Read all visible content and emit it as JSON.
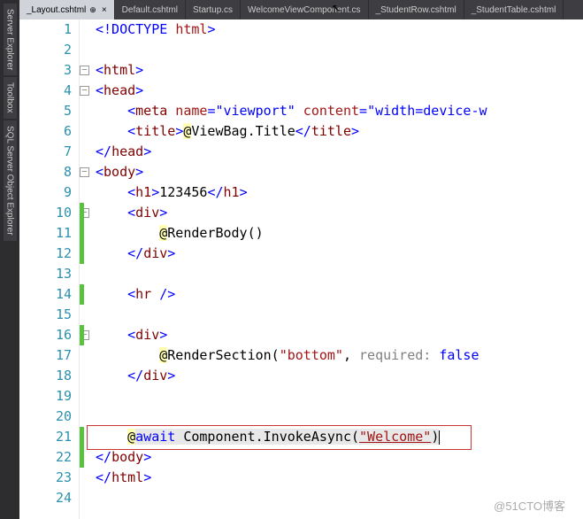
{
  "sidebar": {
    "tabs": [
      "Server Explorer",
      "Toolbox",
      "SQL Server Object Explorer"
    ]
  },
  "tabs": [
    {
      "label": "_Layout.cshtml",
      "active": true,
      "pinned": true
    },
    {
      "label": "Default.cshtml"
    },
    {
      "label": "Startup.cs"
    },
    {
      "label": "WelcomeViewComponent.cs"
    },
    {
      "label": "_StudentRow.cshtml"
    },
    {
      "label": "_StudentTable.cshtml"
    }
  ],
  "code": {
    "l1": {
      "doctype": "<!DOCTYPE ",
      "html": "html",
      "close": ">"
    },
    "l3": {
      "open": "<",
      "tag": "html",
      "close": ">"
    },
    "l4": {
      "open": "<",
      "tag": "head",
      "close": ">"
    },
    "l5": {
      "open": "<",
      "tag": "meta",
      "name_attr": " name",
      "eq": "=",
      "name_val": "\"viewport\"",
      "content_attr": " content",
      "content_val": "\"width=device-w"
    },
    "l6": {
      "open": "<",
      "tag": "title",
      "close": ">",
      "at": "@",
      "razor": "ViewBag.Title",
      "copen": "</",
      "cclose": ">"
    },
    "l7": {
      "open": "</",
      "tag": "head",
      "close": ">"
    },
    "l8": {
      "open": "<",
      "tag": "body",
      "close": ">"
    },
    "l9": {
      "open": "<",
      "tag": "h1",
      "close": ">",
      "text": "123456",
      "copen": "</"
    },
    "l10": {
      "open": "<",
      "tag": "div",
      "close": ">"
    },
    "l11": {
      "at": "@",
      "razor": "RenderBody()"
    },
    "l12": {
      "open": "</",
      "tag": "div",
      "close": ">"
    },
    "l14": {
      "open": "<",
      "tag": "hr",
      "close": "/>"
    },
    "l16": {
      "open": "<",
      "tag": "div",
      "close": ">"
    },
    "l17": {
      "at": "@",
      "razor": "RenderSection(",
      "str": "\"bottom\"",
      "comma": ", ",
      "param": "required:",
      "val": " false"
    },
    "l18": {
      "open": "</",
      "tag": "div",
      "close": ">"
    },
    "l21": {
      "at": "@",
      "kw": "await",
      "text1": " Component.InvokeAsync(",
      "str": "\"Welcome\"",
      "text2": ")"
    },
    "l22": {
      "open": "</",
      "tag": "body",
      "close": ">"
    },
    "l23": {
      "open": "</",
      "tag": "html",
      "close": ">"
    }
  },
  "watermark": "@51CTO博客"
}
